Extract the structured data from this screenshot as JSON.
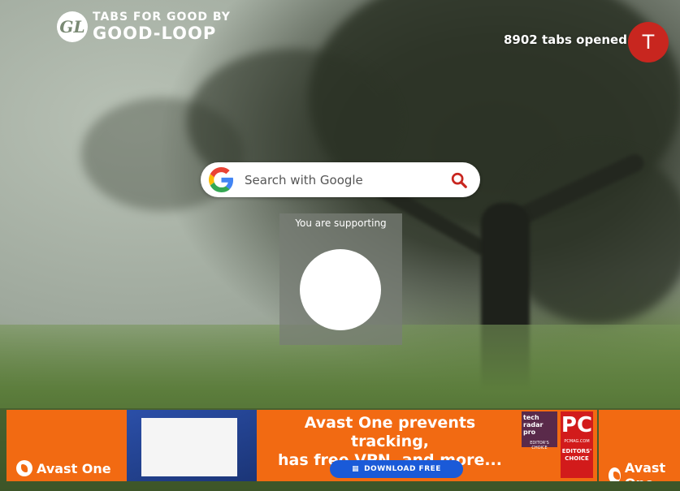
{
  "header": {
    "logo_tagline": "TABS FOR GOOD BY",
    "logo_name": "GOOD-LOOP",
    "tabs_opened": "8902 tabs opened",
    "avatar_initial": "T"
  },
  "search": {
    "placeholder": "Search with Google"
  },
  "charity": {
    "supporting_label": "You are supporting"
  },
  "ad": {
    "brand": "Avast One",
    "headline_line1": "Avast One prevents tracking,",
    "headline_line2": "has free VPN, and more...",
    "cta": "DOWNLOAD FREE",
    "badge1_text": "tech radar pro",
    "badge1_sub": "EDITOR'S CHOICE",
    "badge2_big": "PC",
    "badge2_site": "PCMAG.COM",
    "badge2_sub": "EDITORS' CHOICE",
    "second_brand": "Avast One"
  },
  "colors": {
    "avatar_bg": "#c8261f",
    "ad_bg": "#f26a12",
    "cta_bg": "#1a5ad8"
  }
}
